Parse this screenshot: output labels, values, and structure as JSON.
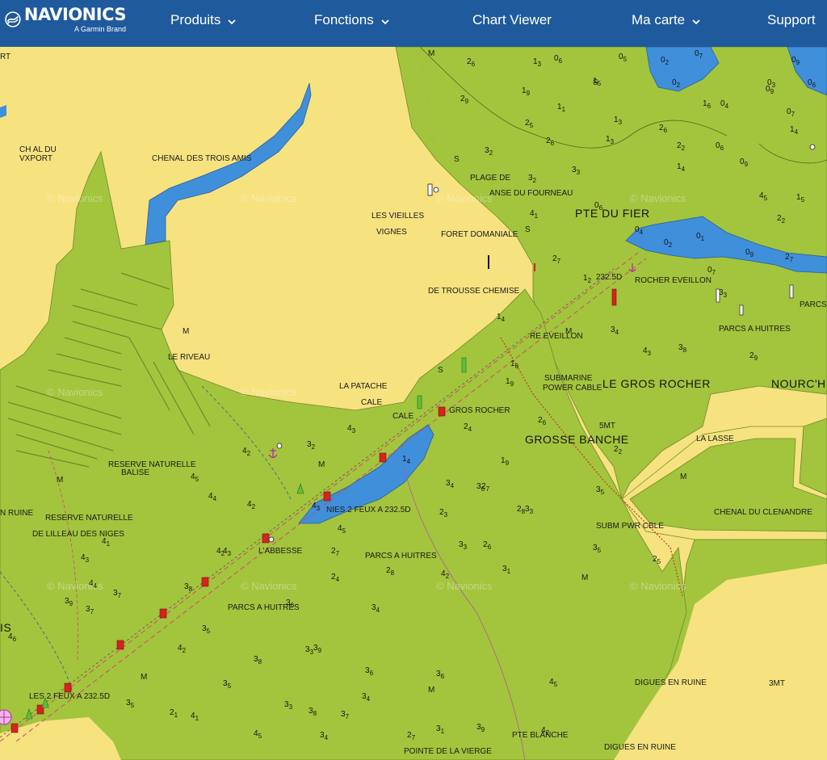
{
  "header": {
    "brand": "NAVIONICS",
    "brand_sub": "A Garmin Brand",
    "nav": [
      {
        "label": "Produits",
        "dropdown": true
      },
      {
        "label": "Fonctions",
        "dropdown": true
      },
      {
        "label": "Chart Viewer",
        "dropdown": false
      },
      {
        "label": "Ma carte",
        "dropdown": true
      },
      {
        "label": "Support",
        "dropdown": false
      }
    ]
  },
  "colors": {
    "header": "#1f5a9d",
    "land": "#f6e27f",
    "intertidal": "#a3c43d",
    "water": "#3f8fdb",
    "buoy_red": "#d6231f",
    "buoy_green": "#5cc13c"
  },
  "map": {
    "watermark": "© Navionics",
    "place_names": [
      "RT",
      "CH AL DU",
      "VXPORT",
      "CHENAL DES TROIS AMIS",
      "PLAGE DE",
      "ANSE DU FOURNEAU",
      "PTE DU FIER",
      "LES VIEILLES",
      "VIGNES",
      "FORET DOMANIALE",
      "DE TROUSSE CHEMISE",
      "232.5D",
      "ROCHER EVEILLON",
      "PARCS",
      "LE RIVEAU",
      "RE EVEILLON",
      "PARCS A HUITRES",
      "LA PATACHE",
      "CALE",
      "CALE",
      "GROS ROCHER",
      "SUBMARINE",
      "POWER CABLE",
      "LE GROS ROCHER",
      "NOURC'H",
      "5MT",
      "GROSSE BANCHE",
      "LA LASSE",
      "RESERVE NATURELLE",
      "BALISE",
      "N RUINE",
      "RESERVE NATURELLE",
      "DE LILLEAU DES NIGES",
      "NIES 2 FEUX A 232.5D",
      "CHENAL DU CLENANDRE",
      "SUBM PWR CBLE",
      "L'ABBESSE",
      "PARCS A HUITRES",
      "PARCS A HUITRES",
      "IS",
      "LES 2 FEUX A 232.5D",
      "DIGUES EN RUINE",
      "3MT",
      "PTE BLANCHE",
      "POINTE DE LA VIERGE",
      "DIGUES EN RUINE",
      "M",
      "M",
      "M",
      "M",
      "M",
      "M",
      "M",
      "M",
      "M",
      "S",
      "S",
      "S",
      "S"
    ],
    "soundings": [
      "26",
      "13",
      "06",
      "05",
      "02",
      "07",
      "09",
      "06",
      "29",
      "19",
      "15",
      "03",
      "02",
      "09",
      "07",
      "25",
      "11",
      "13",
      "26",
      "16",
      "13",
      "04",
      "14",
      "32",
      "26",
      "06",
      "33",
      "22",
      "09",
      "32",
      "14",
      "15",
      "41",
      "06",
      "22",
      "45",
      "04",
      "27",
      "33",
      "01",
      "02",
      "07",
      "09",
      "12",
      "27",
      "14",
      "16",
      "19",
      "34",
      "43",
      "29",
      "38",
      "26",
      "22",
      "24",
      "19",
      "35",
      "36",
      "43",
      "25",
      "14",
      "34",
      "23",
      "27",
      "28",
      "27",
      "33",
      "45",
      "42",
      "32",
      "45",
      "44",
      "42",
      "43",
      "24",
      "28",
      "42",
      "26",
      "33",
      "35",
      "31",
      "37",
      "46",
      "38",
      "41",
      "39",
      "43",
      "37",
      "44",
      "35",
      "36",
      "39",
      "34",
      "38",
      "33",
      "42",
      "43",
      "36",
      "38",
      "34",
      "45",
      "35",
      "42",
      "41",
      "35",
      "27",
      "31",
      "39",
      "42",
      "45",
      "36",
      "37",
      "33",
      "34",
      "21"
    ]
  }
}
